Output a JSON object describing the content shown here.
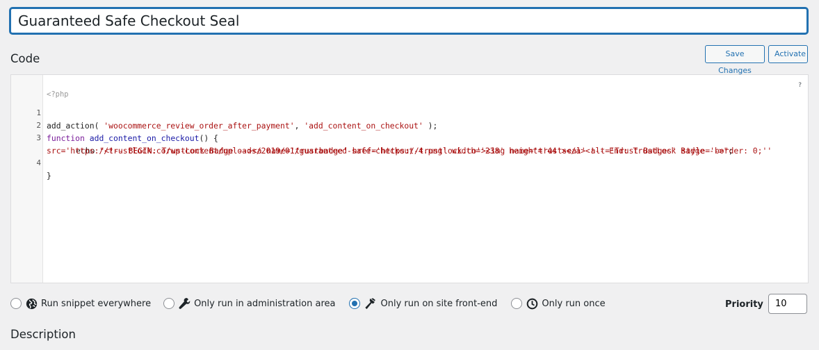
{
  "snippet": {
    "title": "Guaranteed Safe Checkout Seal"
  },
  "code_section": {
    "heading": "Code",
    "save_button": "Save Changes",
    "activate_button": "Activate",
    "help_glyph": "?"
  },
  "editor": {
    "php_open": "<?php",
    "line_numbers": [
      "1",
      "2",
      "3",
      "4"
    ],
    "lines": {
      "l1_fn": "add_action",
      "l1_a": "( ",
      "l1_s1": "'woocommerce_review_order_after_payment'",
      "l1_b": ", ",
      "l1_s2": "'add_content_on_checkout'",
      "l1_c": " );",
      "l2_kw": "function",
      "l2_name": "add_content_on_checkout",
      "l2_rest": "() {",
      "l3_echo": "echo",
      "l3_str": "\"<!-- BEGIN: TrustLock Badge --><a name='trustbadge' href='https://trustlock.co'><img name='trustseal' alt='Trust Badges' style='border: 0;''",
      "l3b_str": "src='https://trustlock.co/wp-content/uploads/2019/01/guaranteed-safe-checkout-4.png' width='238' height='44'></a><!-- End: TrustLock Badge -->\"",
      "l3b_end": ";",
      "l4": "}"
    }
  },
  "run_options": [
    {
      "label": "Run snippet everywhere",
      "icon": "globe-icon",
      "checked": false
    },
    {
      "label": "Only run in administration area",
      "icon": "wrench-icon",
      "checked": false
    },
    {
      "label": "Only run on site front-end",
      "icon": "hammer-icon",
      "checked": true
    },
    {
      "label": "Only run once",
      "icon": "clock-icon",
      "checked": false
    }
  ],
  "priority": {
    "label": "Priority",
    "value": "10"
  },
  "description": {
    "heading": "Description"
  },
  "colors": {
    "accent": "#2271b1",
    "background": "#f0f0f1",
    "string": "#aa1111",
    "keyword": "#7a1d9a"
  }
}
